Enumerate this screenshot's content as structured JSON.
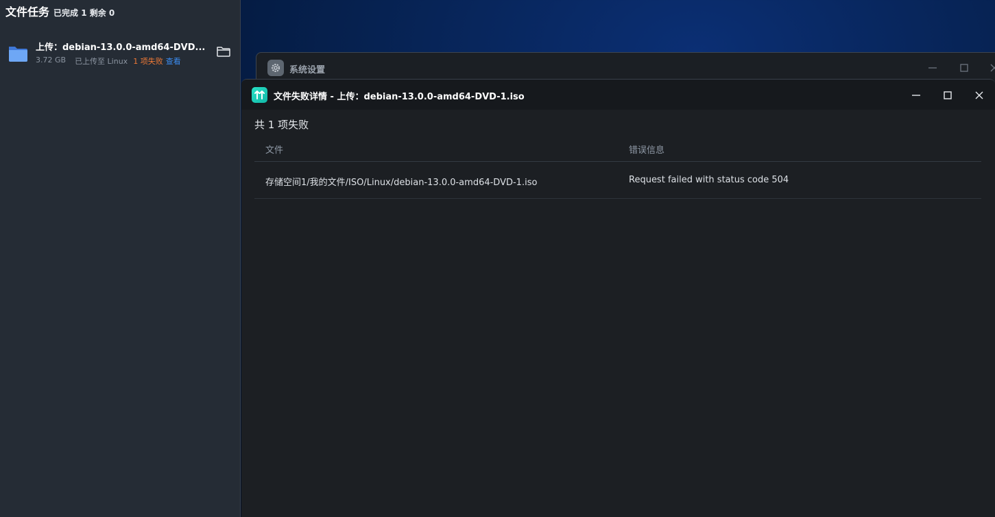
{
  "task_panel": {
    "title": "文件任务",
    "summary": "已完成 1 剩余 0",
    "item": {
      "name": "上传：debian-13.0.0-amd64-DVD...",
      "size": "3.72 GB",
      "status": "已上传至 Linux",
      "failed": "1 项失败",
      "view_link": "查看",
      "icon": "folder-icon",
      "action_icon": "open-folder-icon"
    }
  },
  "settings_window": {
    "title": "系统设置",
    "icon": "gear-icon"
  },
  "detail_window": {
    "title": "文件失败详情 - 上传：debian-13.0.0-amd64-DVD-1.iso",
    "icon": "transfer-app-icon",
    "fail_count": "共 1 项失败",
    "columns": {
      "file": "文件",
      "error": "错误信息"
    },
    "rows": [
      {
        "file": "存储空间1/我的文件/ISO/Linux/debian-13.0.0-amd64-DVD-1.iso",
        "error": "Request failed with status code 504"
      }
    ]
  },
  "colors": {
    "accent_failed": "#f07a36",
    "accent_link": "#3b8cf0",
    "app_icon": "#1fcdb7"
  }
}
